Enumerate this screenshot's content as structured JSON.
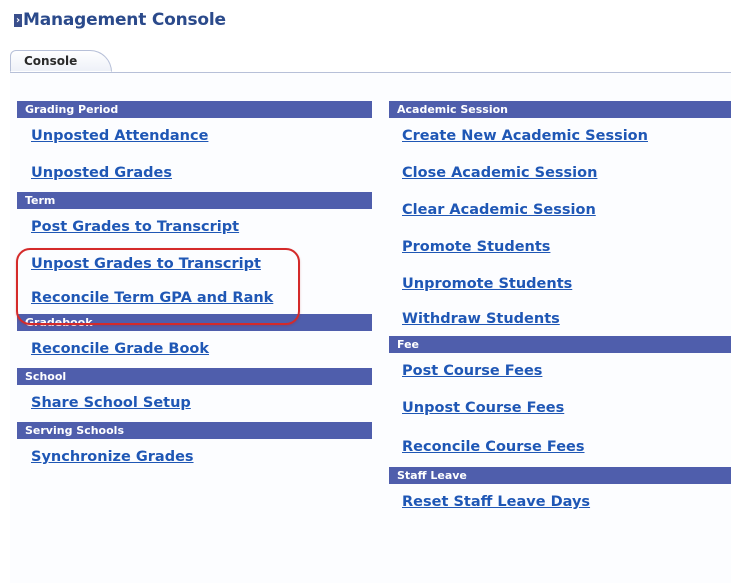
{
  "app": {
    "title": "Management Console"
  },
  "tabs": [
    {
      "label": "Console",
      "active": true
    }
  ],
  "left": {
    "grading_period": {
      "header": "Grading Period",
      "links": [
        "Unposted Attendance",
        "Unposted Grades"
      ]
    },
    "term": {
      "header": "Term",
      "links": [
        "Post Grades to Transcript",
        "Unpost Grades to Transcript",
        "Reconcile Term GPA and Rank"
      ]
    },
    "gradebook": {
      "header": "Gradebook",
      "links": [
        "Reconcile Grade Book"
      ]
    },
    "school": {
      "header": "School",
      "links": [
        "Share School Setup"
      ]
    },
    "serving_schools": {
      "header": "Serving Schools",
      "links": [
        "Synchronize Grades"
      ]
    }
  },
  "right": {
    "academic_session": {
      "header": "Academic Session",
      "links": [
        "Create New Academic Session",
        "Close Academic Session",
        "Clear Academic Session",
        "Promote Students",
        "Unpromote Students",
        "Withdraw Students"
      ]
    },
    "fee": {
      "header": "Fee",
      "links": [
        "Post Course Fees",
        "Unpost Course Fees",
        "Reconcile Course Fees"
      ]
    },
    "staff_leave": {
      "header": "Staff Leave",
      "links": [
        "Reset Staff Leave Days"
      ]
    }
  },
  "colors": {
    "title": "#2b4a8b",
    "section_header_bg": "#4f5eac",
    "link": "#1f57b5",
    "highlight_ring": "#d42a2a"
  }
}
